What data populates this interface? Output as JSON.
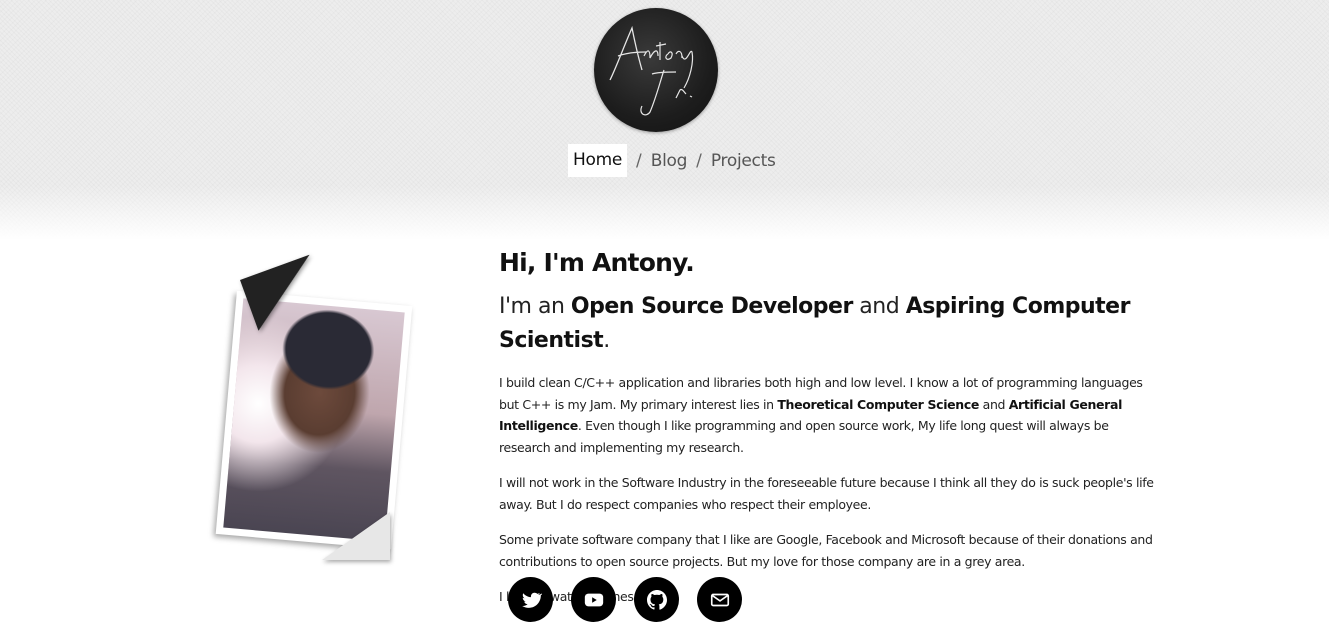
{
  "logo": {
    "text_line1": "Antony",
    "text_line2": "J.r."
  },
  "nav": {
    "items": [
      {
        "label": "Home",
        "active": true
      },
      {
        "label": "Blog",
        "active": false
      },
      {
        "label": "Projects",
        "active": false
      }
    ],
    "separator": "/"
  },
  "hero": {
    "greeting": "Hi, I'm Antony.",
    "tagline_prefix": "I'm an ",
    "tagline_role1": "Open Source Developer",
    "tagline_mid": " and ",
    "tagline_role2": "Aspiring Computer Scientist",
    "tagline_end": "."
  },
  "paragraphs": {
    "p1_a": "I build clean C/C++ application and libraries both high and low level. I know a lot of programming languages but C++ is my Jam. My primary interest lies in ",
    "p1_b": "Theoretical Computer Science",
    "p1_c": " and ",
    "p1_d": "Artificial General Intelligence",
    "p1_e": ". Even though I like programming and open source work, My life long quest will always be research and implementing my research.",
    "p2": "I will not work in the Software Industry in the foreseeable future because I think all they do is suck people's life away. But I do respect companies who respect their employee.",
    "p3": "Some private software company that I like are Google, Facebook and Microsoft because of their donations and contributions to open source projects. But my love for those company are in a grey area.",
    "p4": "I love to watch Animes all day."
  },
  "socials": [
    {
      "icon": "twitter-icon"
    },
    {
      "icon": "youtube-icon"
    },
    {
      "icon": "github-icon"
    },
    {
      "icon": "mail-icon"
    }
  ],
  "colors": {
    "accent": "#000000",
    "background": "#ffffff",
    "header_texture": "#ededed"
  }
}
